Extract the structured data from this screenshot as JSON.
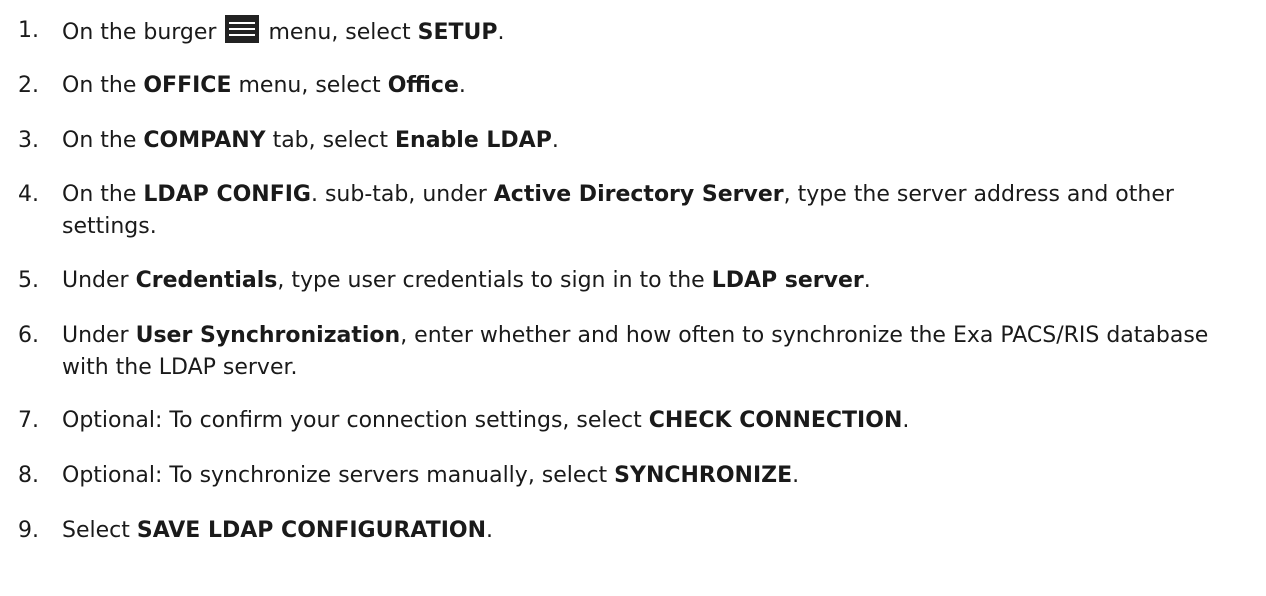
{
  "steps": [
    {
      "num": "1.",
      "parts": [
        {
          "t": "On the burger "
        },
        {
          "icon": "burger-menu-icon"
        },
        {
          "t": " menu, select "
        },
        {
          "b": "SETUP"
        },
        {
          "t": "."
        }
      ]
    },
    {
      "num": "2.",
      "parts": [
        {
          "t": "On the "
        },
        {
          "b": "OFFICE"
        },
        {
          "t": " menu, select "
        },
        {
          "b": "Office"
        },
        {
          "t": "."
        }
      ]
    },
    {
      "num": "3.",
      "parts": [
        {
          "t": "On the "
        },
        {
          "b": "COMPANY"
        },
        {
          "t": " tab, select "
        },
        {
          "b": "Enable LDAP"
        },
        {
          "t": "."
        }
      ]
    },
    {
      "num": "4.",
      "parts": [
        {
          "t": "On the "
        },
        {
          "b": "LDAP CONFIG"
        },
        {
          "t": ". sub-tab, under "
        },
        {
          "b": "Active Directory Server"
        },
        {
          "t": ", type the server address and other settings."
        }
      ]
    },
    {
      "num": "5.",
      "parts": [
        {
          "t": "Under "
        },
        {
          "b": "Credentials"
        },
        {
          "t": ", type user credentials to sign in to the "
        },
        {
          "b": "LDAP server"
        },
        {
          "t": "."
        }
      ]
    },
    {
      "num": "6.",
      "parts": [
        {
          "t": "Under "
        },
        {
          "b": "User Synchronization"
        },
        {
          "t": ", enter whether and how often to synchronize the Exa PACS/RIS database with the LDAP server."
        }
      ]
    },
    {
      "num": "7.",
      "parts": [
        {
          "t": "Optional: To confirm your connection settings, select "
        },
        {
          "b": "CHECK CONNECTION"
        },
        {
          "t": "."
        }
      ]
    },
    {
      "num": "8.",
      "parts": [
        {
          "t": "Optional: To synchronize servers manually, select "
        },
        {
          "b": "SYNCHRONIZE"
        },
        {
          "t": "."
        }
      ]
    },
    {
      "num": "9.",
      "parts": [
        {
          "t": "Select "
        },
        {
          "b": "SAVE LDAP CONFIGURATION"
        },
        {
          "t": "."
        }
      ]
    }
  ]
}
